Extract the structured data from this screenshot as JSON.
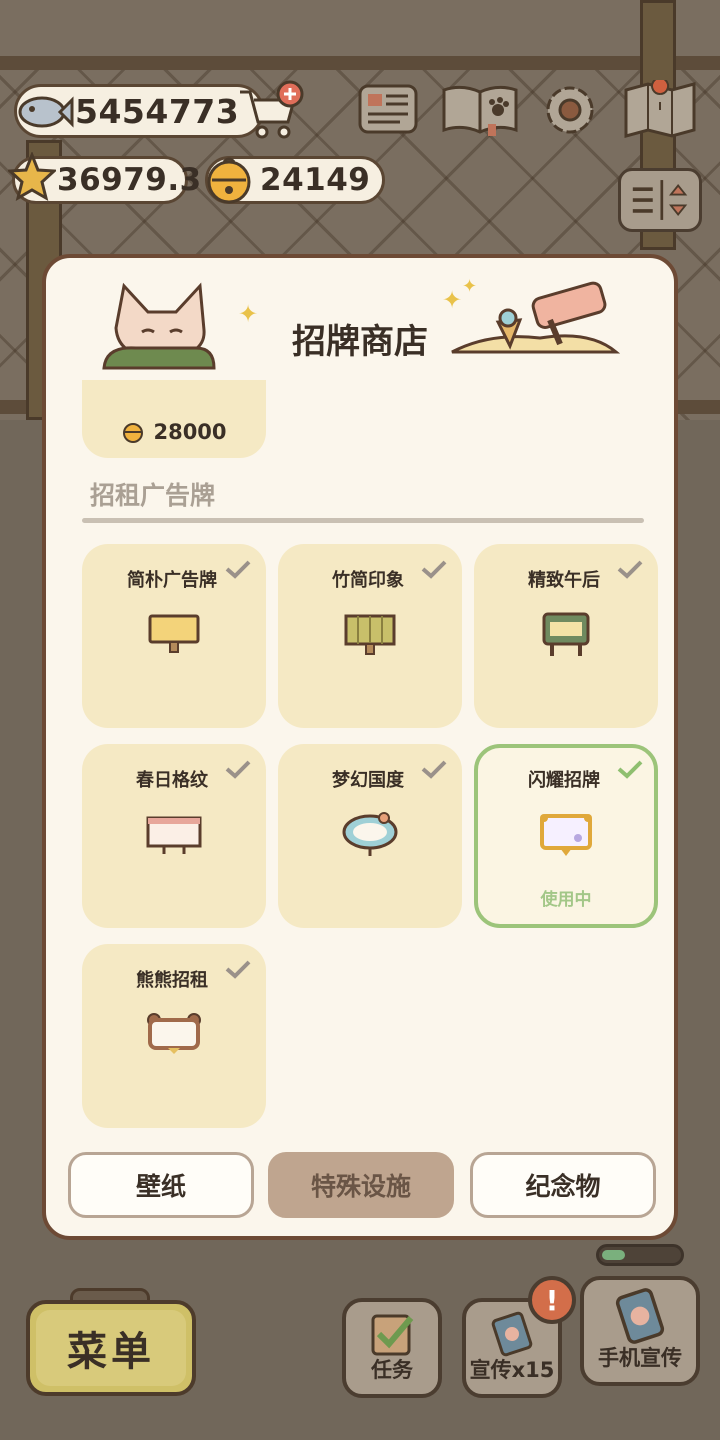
{
  "currencies": {
    "fish": "5454773",
    "stars": "36979.3",
    "bells": "24149"
  },
  "icons": [
    "fish-icon",
    "star-icon",
    "bell-icon",
    "cart-plus-icon",
    "newspaper-icon",
    "paw-book-icon",
    "gear-icon",
    "map-icon",
    "sort-icon",
    "clipboard-check-icon",
    "phone-promo-icon"
  ],
  "modal": {
    "title": "招牌商店",
    "previous_item_price": "28000",
    "section_label": "招租广告牌",
    "items": [
      {
        "name": "简朴广告牌",
        "owned": true,
        "active": false
      },
      {
        "name": "竹简印象",
        "owned": true,
        "active": false
      },
      {
        "name": "精致午后",
        "owned": true,
        "active": false
      },
      {
        "name": "春日格纹",
        "owned": true,
        "active": false
      },
      {
        "name": "梦幻国度",
        "owned": true,
        "active": false
      },
      {
        "name": "闪耀招牌",
        "owned": true,
        "active": true,
        "status": "使用中"
      },
      {
        "name": "熊熊招租",
        "owned": true,
        "active": false
      }
    ],
    "tabs": [
      {
        "label": "壁纸",
        "selected": false
      },
      {
        "label": "特殊设施",
        "selected": true
      },
      {
        "label": "纪念物",
        "selected": false
      }
    ]
  },
  "bottom_bar": {
    "menu_label": "菜单",
    "task_label": "任务",
    "promo_label": "宣传x15",
    "phone_promo_label": "手机宣传",
    "alert": "!",
    "progress_fraction": 0.3
  },
  "colors": {
    "active_border": "#9cc47a",
    "card_bg": "#f5e9c4",
    "selected_tab": "#bfa58f"
  }
}
